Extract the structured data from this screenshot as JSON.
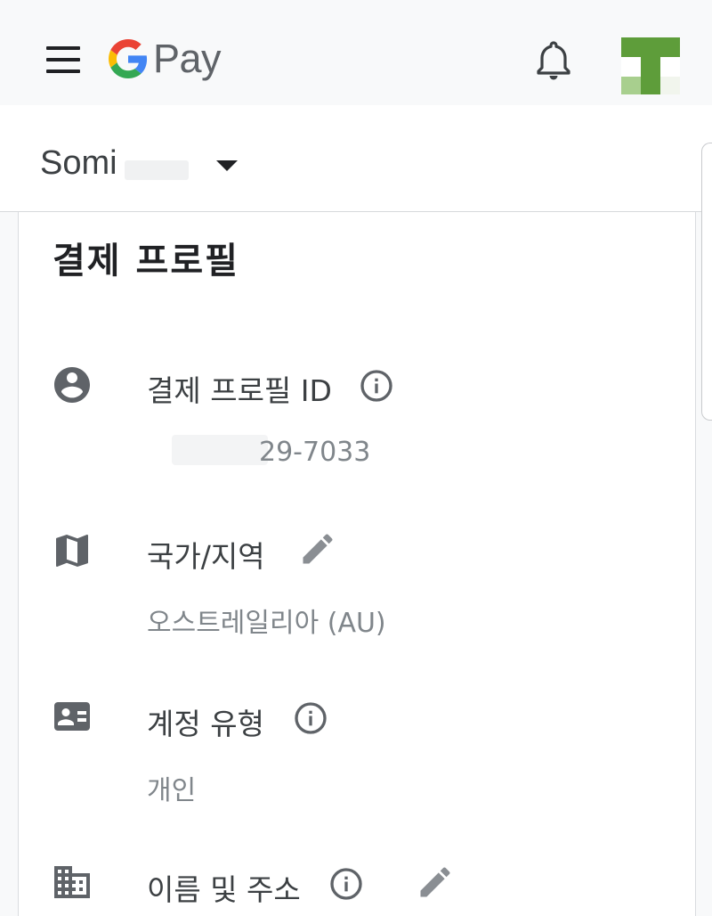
{
  "header": {
    "logo_text": "Pay",
    "menu_icon": "hamburger-menu-icon",
    "bell_icon": "bell-icon",
    "avatar_colors": [
      "#5e9d3a",
      "#a8cf8e"
    ]
  },
  "account": {
    "name": "Somi",
    "dropdown_icon": "triangle-down-icon"
  },
  "profile": {
    "title": "결제 프로필",
    "rows": [
      {
        "icon": "account-circle-icon",
        "label": "결제 프로필 ID",
        "value": "29-7033",
        "info": true,
        "edit": false
      },
      {
        "icon": "map-icon",
        "label": "국가/지역",
        "value": "오스트레일리아 (AU)",
        "info": false,
        "edit": true
      },
      {
        "icon": "contact-card-icon",
        "label": "계정 유형",
        "value": "개인",
        "info": true,
        "edit": false
      },
      {
        "icon": "business-building-icon",
        "label": "이름 및 주소",
        "value": "",
        "info": true,
        "edit": true
      }
    ]
  },
  "colors": {
    "icon_gray": "#5f6368",
    "text_value": "#80868b",
    "google_blue": "#4285f4",
    "google_red": "#ea4335",
    "google_yellow": "#fbbc05",
    "google_green": "#34a853"
  }
}
